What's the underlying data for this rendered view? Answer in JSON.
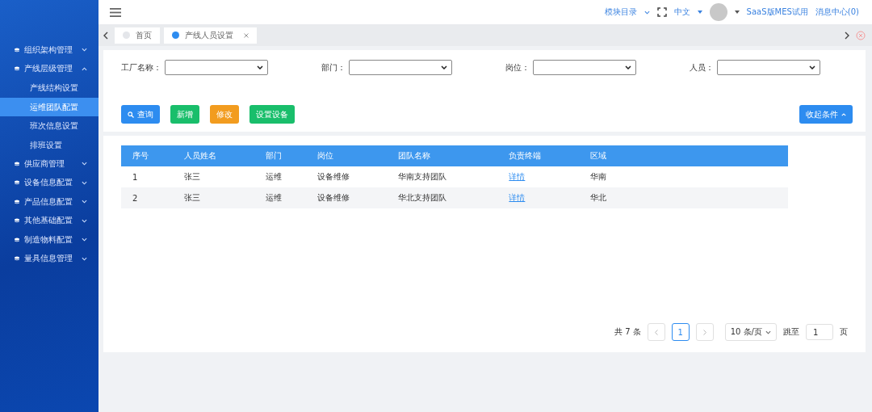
{
  "header": {
    "module_menu": "模块目录",
    "language": "中文",
    "user": "SaaS版MES试用",
    "messages": "消息中心(0)"
  },
  "tabs": [
    {
      "label": "首页",
      "selected": false,
      "closable": false
    },
    {
      "label": "产线人员设置",
      "selected": true,
      "closable": true
    }
  ],
  "sidebar": {
    "items": [
      {
        "label": "组织架构管理",
        "expanded": false
      },
      {
        "label": "产线层级管理",
        "expanded": true,
        "children": [
          {
            "label": "产线结构设置",
            "selected": false
          },
          {
            "label": "运维团队配置",
            "selected": true
          },
          {
            "label": "班次信息设置",
            "selected": false
          },
          {
            "label": "排班设置",
            "selected": false
          }
        ]
      },
      {
        "label": "供应商管理",
        "expanded": false
      },
      {
        "label": "设备信息配置",
        "expanded": false
      },
      {
        "label": "产品信息配置",
        "expanded": false
      },
      {
        "label": "其他基础配置",
        "expanded": false
      },
      {
        "label": "制造物料配置",
        "expanded": false
      },
      {
        "label": "量具信息管理",
        "expanded": false
      }
    ]
  },
  "filters": [
    {
      "label": "工厂名称："
    },
    {
      "label": "部门："
    },
    {
      "label": "岗位："
    },
    {
      "label": "人员："
    }
  ],
  "buttons": [
    {
      "label": "查询",
      "kind": "search"
    },
    {
      "label": "新增",
      "kind": "add"
    },
    {
      "label": "修改",
      "kind": "edit"
    },
    {
      "label": "设置设备",
      "kind": "add"
    }
  ],
  "collapse_button": "收起条件",
  "table": {
    "columns": [
      "序号",
      "人员姓名",
      "部门",
      "岗位",
      "团队名称",
      "负责终端",
      "区域"
    ],
    "rows": [
      [
        "1",
        "张三",
        "运维",
        "设备维修",
        "华南支持团队",
        "详情",
        "华南"
      ],
      [
        "2",
        "张三",
        "运维",
        "设备维修",
        "华北支持团队",
        "详情",
        "华北"
      ]
    ]
  },
  "pagination": {
    "total": "共 7 条",
    "current_page": "1",
    "page_size": "10 条/页",
    "goto_label": "跳至",
    "goto_value": "1",
    "page_suffix": "页"
  }
}
